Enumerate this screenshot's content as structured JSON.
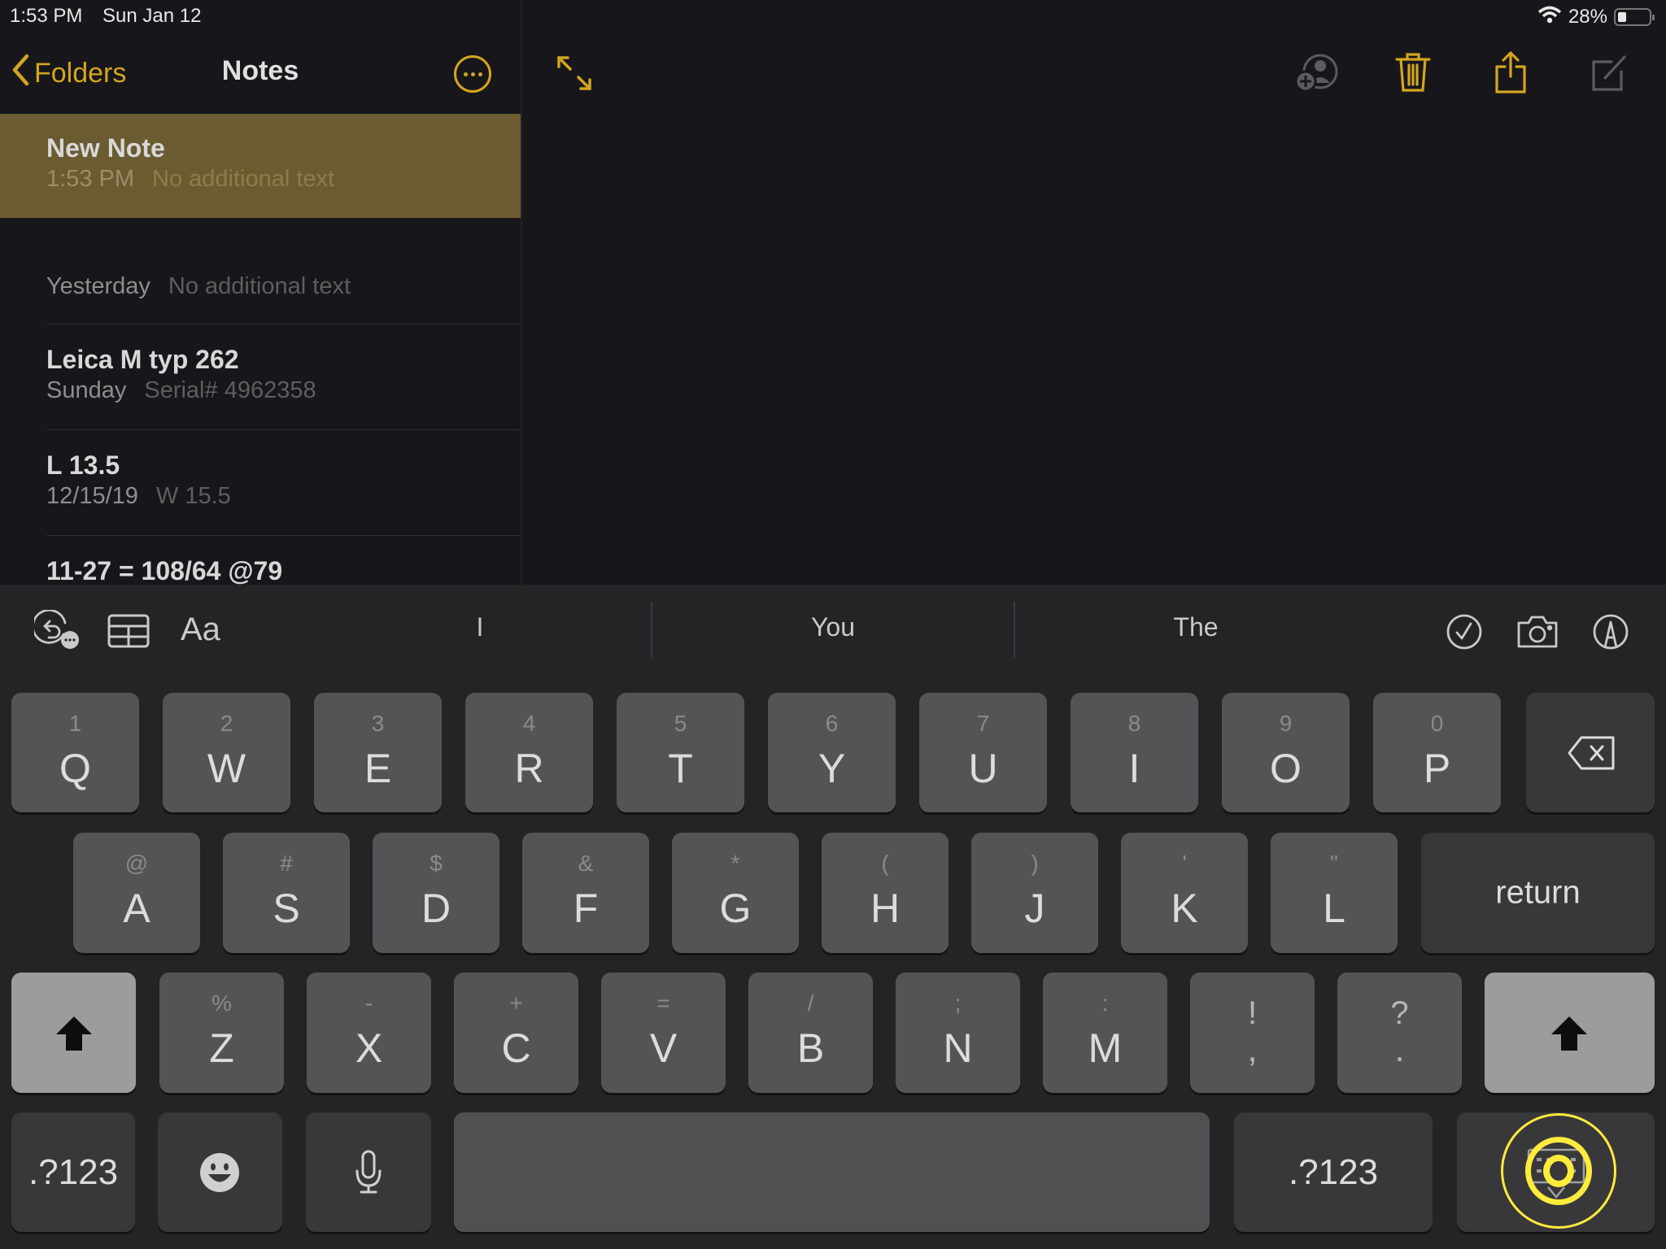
{
  "status_bar": {
    "time": "1:53 PM",
    "date": "Sun Jan 12",
    "battery": "28%",
    "battery_level_percent": 28
  },
  "sidebar": {
    "back_label": "Folders",
    "title": "Notes",
    "notes": [
      {
        "title": "New Note",
        "date": "1:53 PM",
        "preview": "No additional text",
        "selected": true
      },
      {
        "title": "",
        "date": "Yesterday",
        "preview": "No additional text"
      },
      {
        "title": "Leica M typ 262",
        "date": "Sunday",
        "preview": "Serial# 4962358"
      },
      {
        "title": "L 13.5",
        "date": "12/15/19",
        "preview": "W 15.5"
      },
      {
        "title": "11-27 = 108/64 @79",
        "date": "",
        "preview": ""
      }
    ]
  },
  "editor_toolbar": {
    "icons": [
      "expand-icon",
      "add-person-icon",
      "trash-icon",
      "share-icon",
      "compose-icon"
    ]
  },
  "keyboard": {
    "toolbar_left": {
      "format_label": "Aa"
    },
    "suggestions": [
      "I",
      "You",
      "The"
    ],
    "rows": [
      [
        {
          "main": "Q",
          "alt": "1"
        },
        {
          "main": "W",
          "alt": "2"
        },
        {
          "main": "E",
          "alt": "3"
        },
        {
          "main": "R",
          "alt": "4"
        },
        {
          "main": "T",
          "alt": "5"
        },
        {
          "main": "Y",
          "alt": "6"
        },
        {
          "main": "U",
          "alt": "7"
        },
        {
          "main": "I",
          "alt": "8"
        },
        {
          "main": "O",
          "alt": "9"
        },
        {
          "main": "P",
          "alt": "0"
        }
      ],
      [
        {
          "main": "A",
          "alt": "@"
        },
        {
          "main": "S",
          "alt": "#"
        },
        {
          "main": "D",
          "alt": "$"
        },
        {
          "main": "F",
          "alt": "&"
        },
        {
          "main": "G",
          "alt": "*"
        },
        {
          "main": "H",
          "alt": "("
        },
        {
          "main": "J",
          "alt": ")"
        },
        {
          "main": "K",
          "alt": "'"
        },
        {
          "main": "L",
          "alt": "\""
        }
      ],
      [
        {
          "main": "Z",
          "alt": "%"
        },
        {
          "main": "X",
          "alt": "-"
        },
        {
          "main": "C",
          "alt": "+"
        },
        {
          "main": "V",
          "alt": "="
        },
        {
          "main": "B",
          "alt": "/"
        },
        {
          "main": "N",
          "alt": ";"
        },
        {
          "main": "M",
          "alt": ":"
        },
        {
          "main": ",",
          "alt": "!"
        },
        {
          "main": ".",
          "alt": "?"
        }
      ]
    ],
    "return_label": "return",
    "numbers_label": ".?123",
    "numbers_label_right": ".?123"
  },
  "colors": {
    "accent": "#d4a51f",
    "selected_row": "#6b5b31",
    "background": "#17171b",
    "keyboard_bg": "#242427",
    "letter_key": "#545456",
    "function_key": "#38383b",
    "shift_key": "#9c9c9e",
    "tap_highlight": "#ffeb3b"
  }
}
